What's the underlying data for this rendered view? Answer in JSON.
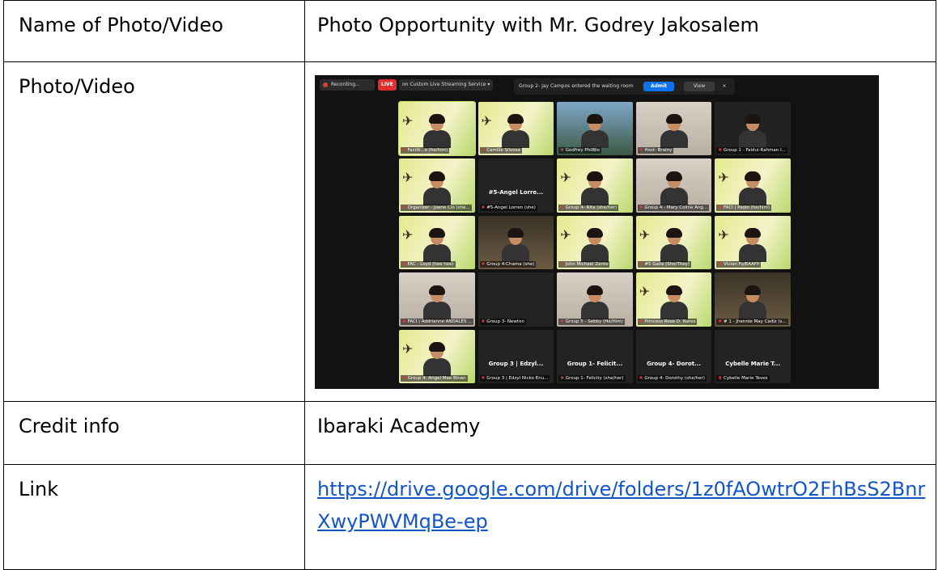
{
  "table": {
    "rows": [
      {
        "label": "Name of Photo/Video",
        "value": "Photo Opportunity with Mr. Godrey Jakosalem"
      },
      {
        "label": "Photo/Video"
      },
      {
        "label": "Credit info",
        "value": "Ibaraki Academy"
      },
      {
        "label": "Link",
        "value": "https://drive.google.com/drive/folders/1z0fAOwtrO2FhBsS2BnrXwyPWVMqBe-ep"
      }
    ]
  },
  "meeting": {
    "recording_label": "Recording...",
    "live_badge": "LIVE",
    "live_service": "on Custom Live Streaming Service ▾",
    "waiting_notice": "Group 2- Jay Campos entered the waiting room",
    "admit_label": "Admit",
    "view_label": "View",
    "close_glyph": "×",
    "tiles": [
      {
        "name": "Facilit...e (he/him)",
        "video": "poster"
      },
      {
        "name": "Camille Silvosa",
        "video": "poster"
      },
      {
        "name": "Godfrey PhilBio",
        "video": "sky"
      },
      {
        "name": "Host- Brainy",
        "video": "wall"
      },
      {
        "name": "Group 1 - Faidul-Rahman I...",
        "video": "dark"
      },
      {
        "name": "Organizer - Joene Cio (she...",
        "video": "poster"
      },
      {
        "name": "#5-Angel Lorren (she)",
        "video": "none",
        "big": "#5-Angel Lorre..."
      },
      {
        "name": "Group 4- Rita (she/her)",
        "video": "poster"
      },
      {
        "name": "Group 4 - Mary Coline Ang...",
        "video": "wall"
      },
      {
        "name": "FACI | Paolo (he/him)",
        "video": "poster"
      },
      {
        "name": "FAC - Loyd (hee hee)",
        "video": "poster"
      },
      {
        "name": "Group 4-Chama (she)",
        "video": "room"
      },
      {
        "name": "John Michael Zante",
        "video": "poster"
      },
      {
        "name": "#5 Gaile (She/They)",
        "video": "poster"
      },
      {
        "name": "Vivian Fu/EAAFP",
        "video": "poster"
      },
      {
        "name": "FACI | Addrianne ANDALES ...",
        "video": "wall"
      },
      {
        "name": "Group 3- Newton",
        "video": "none",
        "big": ""
      },
      {
        "name": "Group 5 - Sebby (He/Him)",
        "video": "wall"
      },
      {
        "name": "Princess Rose D. Nares",
        "video": "poster"
      },
      {
        "name": "# 1 - Jhennie May Cadiz (s...",
        "video": "room"
      },
      {
        "name": "Group 4- Angel Mae Binan",
        "video": "poster"
      },
      {
        "name": "Group 3 | Edzyl Nicko Enu...",
        "video": "none",
        "big": "Group 3 | Edzyl..."
      },
      {
        "name": "Group 1- Felicity (she/her)",
        "video": "none",
        "big": "Group 1- Felicit..."
      },
      {
        "name": "Group 4- Dorothy (she/her)",
        "video": "none",
        "big": "Group 4- Dorot..."
      },
      {
        "name": "Cybelle Marie Teves",
        "video": "none",
        "big": "Cybelle Marie T..."
      }
    ]
  }
}
